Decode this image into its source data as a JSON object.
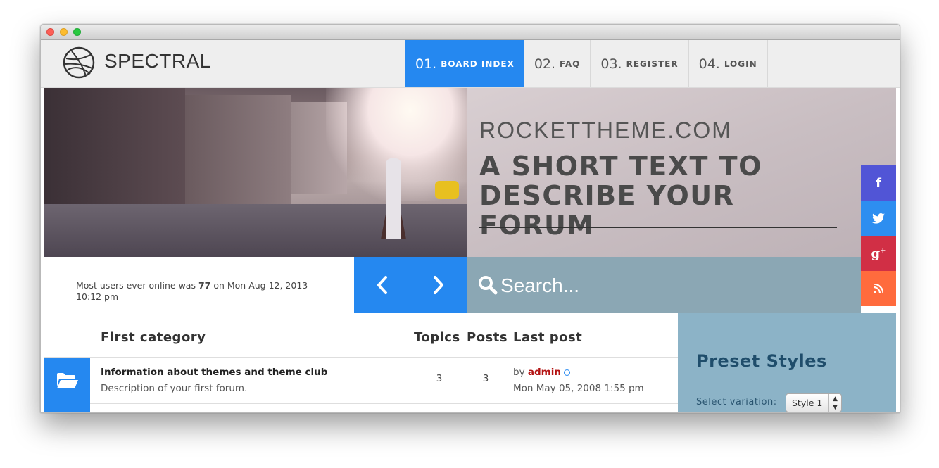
{
  "brand": {
    "name": "SPECTRAL"
  },
  "nav": [
    {
      "num": "01.",
      "label": "BOARD INDEX"
    },
    {
      "num": "02.",
      "label": "FAQ"
    },
    {
      "num": "03.",
      "label": "REGISTER"
    },
    {
      "num": "04.",
      "label": "LOGIN"
    }
  ],
  "hero": {
    "kicker": "ROCKETTHEME.COM",
    "title": "A SHORT TEXT TO DESCRIBE YOUR FORUM"
  },
  "social": {
    "facebook": "f",
    "twitter": "t",
    "googleplus": "g+",
    "rss": "rss"
  },
  "stats": {
    "prefix": "Most users ever online was ",
    "count": "77",
    "suffix": " on Mon Aug 12, 2013 10:12 pm"
  },
  "search": {
    "placeholder": "Search..."
  },
  "forum": {
    "category": "First category",
    "columns": {
      "topics": "Topics",
      "posts": "Posts",
      "last_post": "Last post"
    },
    "rows": [
      {
        "name": "Information about themes and theme club",
        "description": "Description of your first forum.",
        "topics": "3",
        "posts": "3",
        "by_label": "by",
        "by_user": "admin",
        "date": "Mon May 05, 2008 1:55 pm"
      }
    ]
  },
  "preset": {
    "title": "Preset Styles",
    "label": "Select variation:",
    "selected": "Style 1"
  },
  "colors": {
    "accent": "#2588f0",
    "search_bg": "#8ba7b4",
    "preset_bg": "#8cb3c7",
    "user_link": "#b31212"
  }
}
